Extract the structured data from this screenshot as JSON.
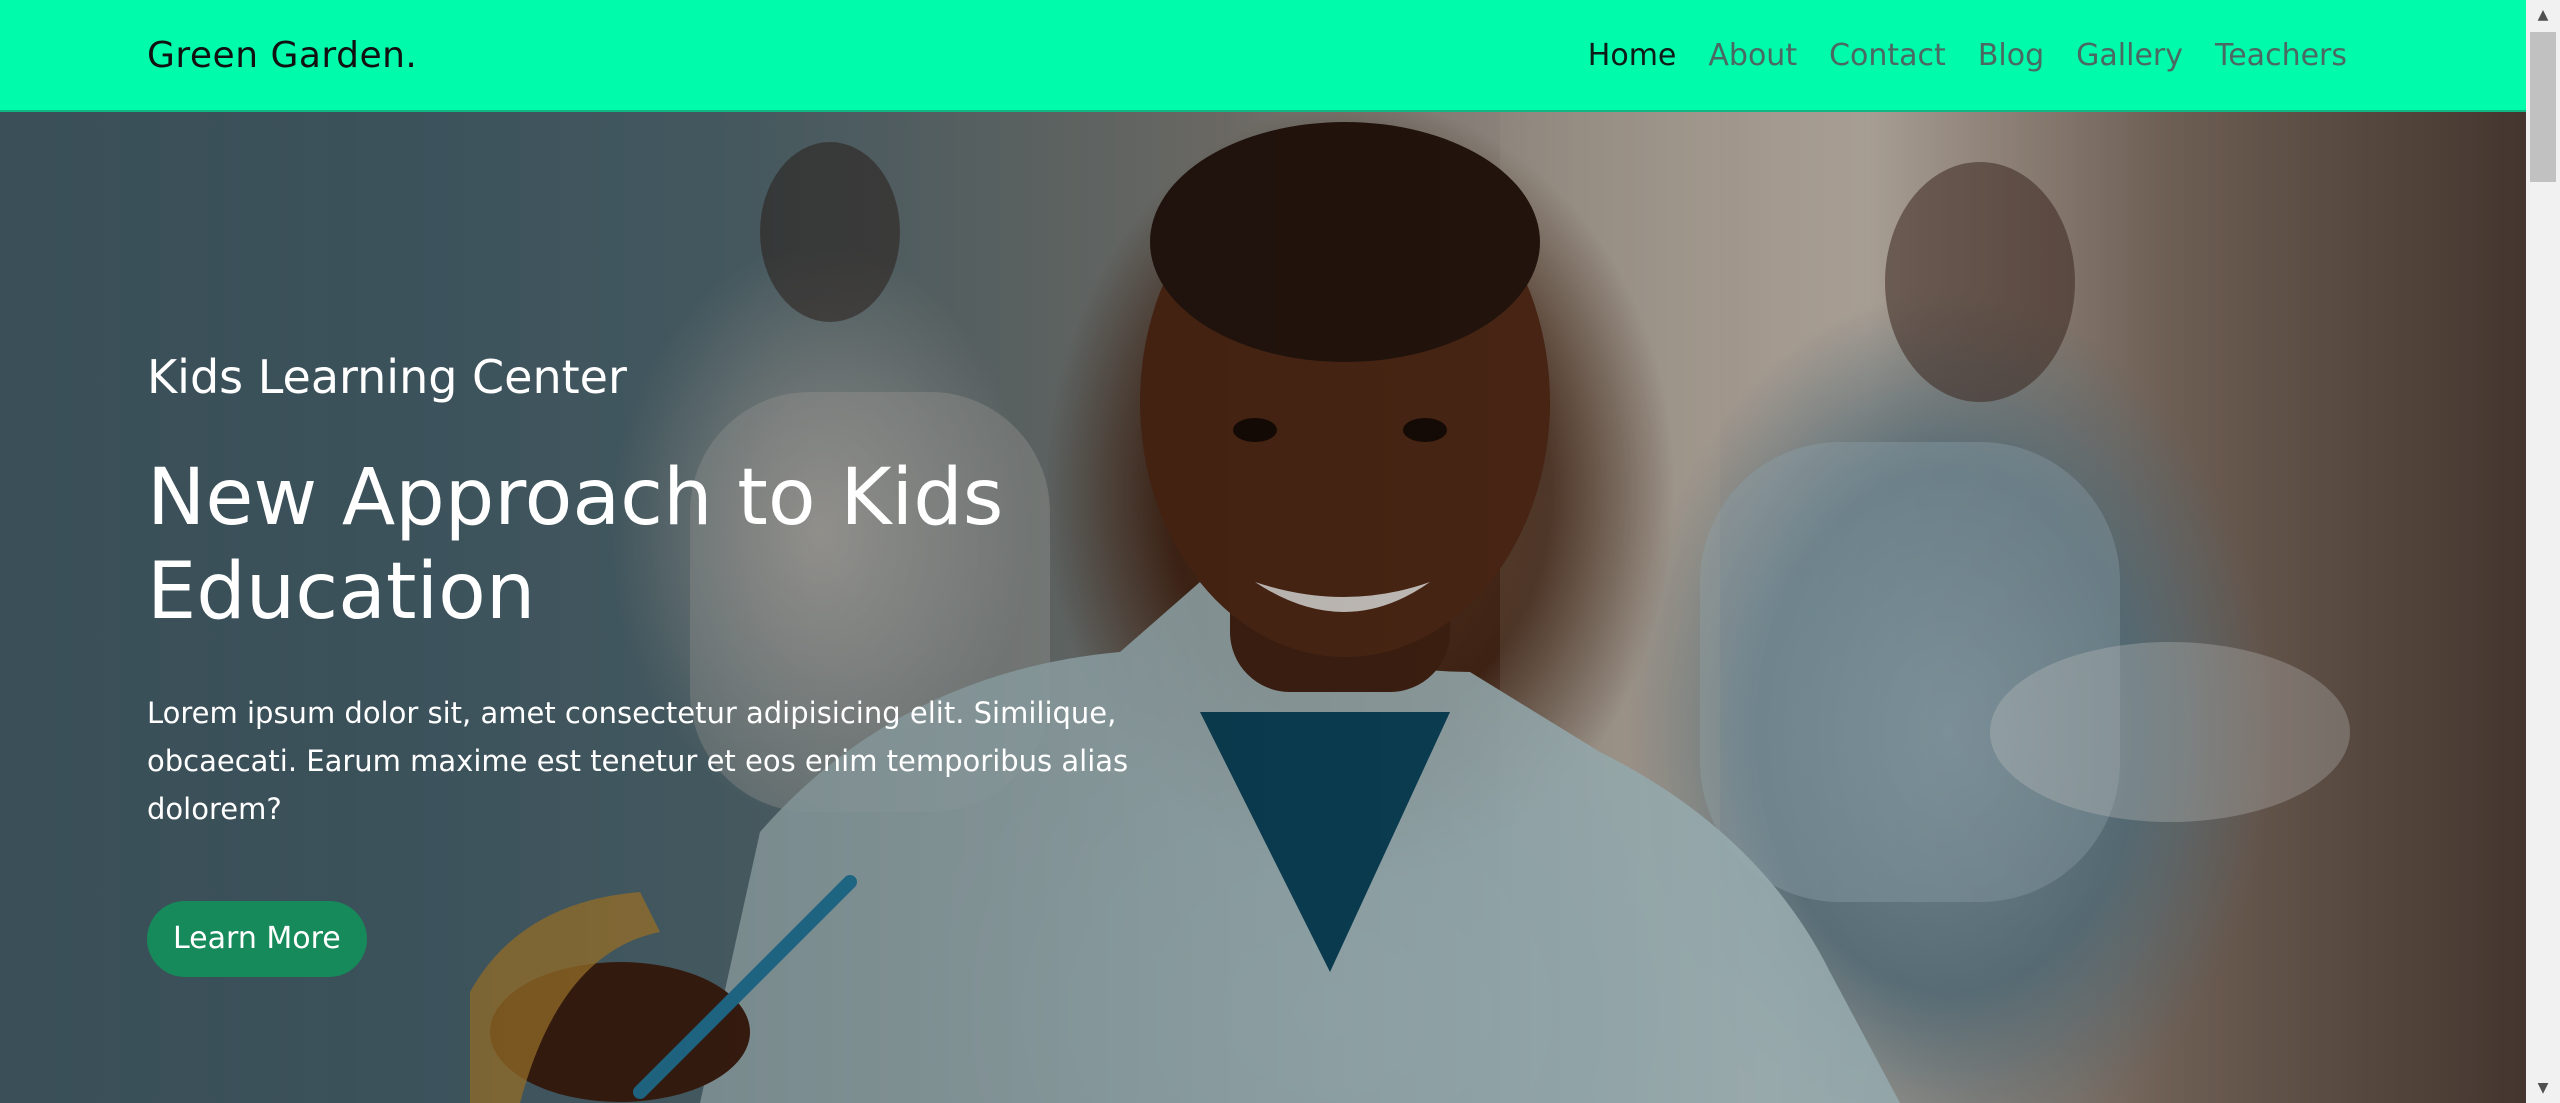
{
  "nav": {
    "brand": "Green Garden.",
    "links": [
      "Home",
      "About",
      "Contact",
      "Blog",
      "Gallery",
      "Teachers"
    ],
    "active": "Home"
  },
  "hero": {
    "subtitle": "Kids Learning Center",
    "title_line1": "New Approach to Kids",
    "title_line2": "Education",
    "text": "Lorem ipsum dolor sit, amet consectetur adipisicing elit. Similique, obcaecati. Earum maxime est tenetur et eos enim temporibus alias dolorem?",
    "button": "Learn More",
    "image": "smiling-student-photo"
  },
  "colors": {
    "navbar": "#00fcaa",
    "button": "#168a5a",
    "hero_text": "#ffffff"
  },
  "scrollbar": {
    "up_icon": "scroll-up-arrow-icon",
    "down_icon": "scroll-down-arrow-icon"
  }
}
